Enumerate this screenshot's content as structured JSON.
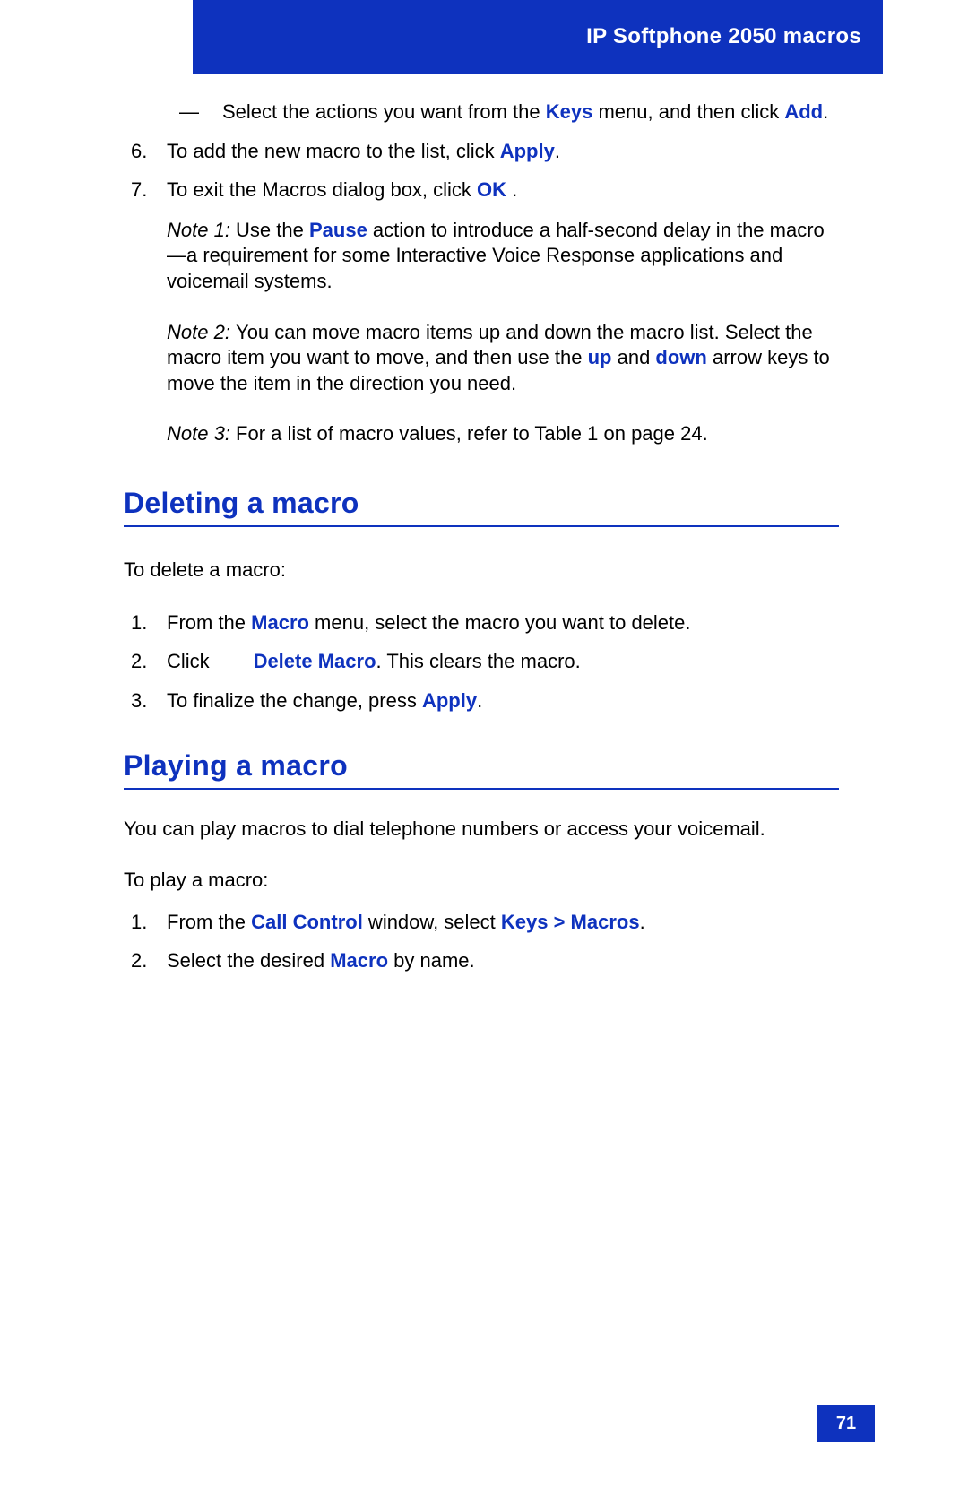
{
  "header": {
    "title": "IP Softphone 2050 macros"
  },
  "introDash": {
    "pre": "Select the actions you want from the ",
    "keys": "Keys",
    "mid": " menu, and then click ",
    "add": "Add",
    "post": "."
  },
  "step6": {
    "num": "6.",
    "pre": "To add the new macro to the list, click ",
    "apply": "Apply",
    "post": "."
  },
  "step7": {
    "num": "7.",
    "pre": "To exit the Macros dialog box, click ",
    "ok": "OK",
    "post": " ."
  },
  "note1": {
    "label": "Note 1: ",
    "pre": "Use the ",
    "pause": "Pause",
    "post": " action to introduce a half-second delay in the macro—a requirement for some Interactive Voice Response applications and voicemail systems."
  },
  "note2": {
    "label": "Note 2: ",
    "pre": "You can move macro items up and down the macro list. Select the macro item you want to move, and then use the ",
    "up": "up",
    "mid": " and ",
    "down": "down",
    "post": " arrow keys to move the item in the direction you need."
  },
  "note3": {
    "label": "Note 3: ",
    "text": "For a list of macro values, refer to Table 1 on page 24."
  },
  "section1": {
    "title": "Deleting a macro",
    "intro": "To delete a macro:",
    "items": [
      {
        "num": "1.",
        "pre": "From the ",
        "b1": "Macro",
        "post": " menu, select the macro you want to delete."
      },
      {
        "num": "2.",
        "pre": "Click        ",
        "b1": "Delete Macro",
        "post": ". This clears the macro."
      },
      {
        "num": "3.",
        "pre": "To finalize the change, press ",
        "b1": "Apply",
        "post": "."
      }
    ]
  },
  "section2": {
    "title": "Playing a macro",
    "intro1": "You can play macros to dial telephone numbers or access your voicemail.",
    "intro2": "To play a macro:",
    "items": [
      {
        "num": "1.",
        "pre": "From the ",
        "b1": "Call Control",
        "mid": " window, select ",
        "b2": "Keys > Macros",
        "post": "."
      },
      {
        "num": "2.",
        "pre": "Select the desired ",
        "b1": "Macro",
        "post": " by name."
      }
    ]
  },
  "pageNumber": "71"
}
